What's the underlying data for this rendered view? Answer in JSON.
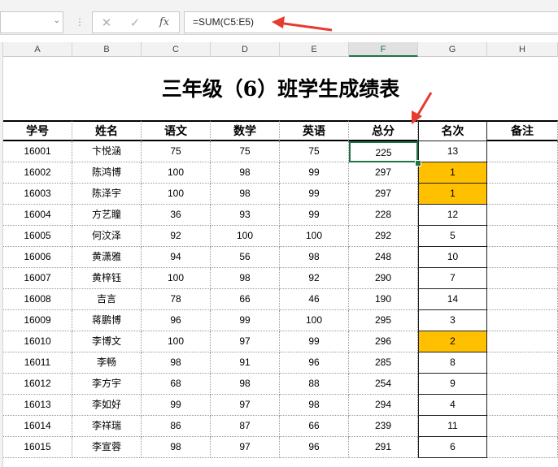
{
  "formula_bar": {
    "formula": "=SUM(C5:E5)",
    "fx_label": "fx"
  },
  "columns": [
    "A",
    "B",
    "C",
    "D",
    "E",
    "F",
    "G",
    "H"
  ],
  "selected_column": "F",
  "sheet": {
    "title": "三年级（6）班学生成绩表",
    "headers": [
      "学号",
      "姓名",
      "语文",
      "数学",
      "英语",
      "总分",
      "名次",
      "备注"
    ],
    "rows": [
      [
        "16001",
        "卞悦涵",
        "75",
        "75",
        "75",
        "225",
        "13",
        ""
      ],
      [
        "16002",
        "陈鸿博",
        "100",
        "98",
        "99",
        "297",
        "1",
        ""
      ],
      [
        "16003",
        "陈泽宇",
        "100",
        "98",
        "99",
        "297",
        "1",
        ""
      ],
      [
        "16004",
        "方艺瞳",
        "36",
        "93",
        "99",
        "228",
        "12",
        ""
      ],
      [
        "16005",
        "何汶泽",
        "92",
        "100",
        "100",
        "292",
        "5",
        ""
      ],
      [
        "16006",
        "黄潇雅",
        "94",
        "56",
        "98",
        "248",
        "10",
        ""
      ],
      [
        "16007",
        "黄梓钰",
        "100",
        "98",
        "92",
        "290",
        "7",
        ""
      ],
      [
        "16008",
        "吉言",
        "78",
        "66",
        "46",
        "190",
        "14",
        ""
      ],
      [
        "16009",
        "蒋鹏博",
        "96",
        "99",
        "100",
        "295",
        "3",
        ""
      ],
      [
        "16010",
        "李博文",
        "100",
        "97",
        "99",
        "296",
        "2",
        ""
      ],
      [
        "16011",
        "李畅",
        "98",
        "91",
        "96",
        "285",
        "8",
        ""
      ],
      [
        "16012",
        "李方宇",
        "68",
        "98",
        "88",
        "254",
        "9",
        ""
      ],
      [
        "16013",
        "李如好",
        "99",
        "97",
        "98",
        "294",
        "4",
        ""
      ],
      [
        "16014",
        "李祥瑞",
        "86",
        "87",
        "66",
        "239",
        "11",
        ""
      ],
      [
        "16015",
        "李宣蓉",
        "98",
        "97",
        "96",
        "291",
        "6",
        ""
      ]
    ],
    "highlighted_rank_rows": [
      1,
      2,
      9
    ],
    "highlight_color": "#ffc000",
    "active_cell": "F5"
  },
  "colors": {
    "accent_green": "#217346",
    "arrow_red": "#e63b2e"
  },
  "icons": {
    "cancel": "✕",
    "enter": "✓",
    "dropdown": "⌄",
    "separator": "⋮"
  }
}
